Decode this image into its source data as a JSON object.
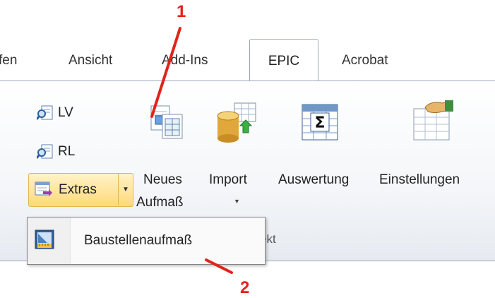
{
  "tabs": {
    "partial_left": "fen",
    "view": "Ansicht",
    "addins": "Add-Ins",
    "epic": "EPIC",
    "acrobat": "Acrobat"
  },
  "ribbon": {
    "lv_label": "LV",
    "rl_label": "RL",
    "extras_label": "Extras",
    "new_measure_line1": "Neues",
    "new_measure_line2": "Aufmaß",
    "import_label": "Import",
    "evaluation_label": "Auswertung",
    "settings_label": "Einstellungen",
    "group_label_partial": "ekt"
  },
  "extras_menu": {
    "items": [
      {
        "label": "Baustellenaufmaß",
        "icon": "site-measure-icon"
      }
    ]
  },
  "annotations": {
    "callout_1": "1",
    "callout_2": "2",
    "color": "#e2231a"
  }
}
